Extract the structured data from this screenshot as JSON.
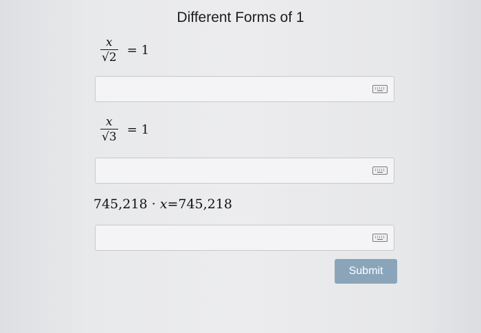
{
  "title": "Different Forms of 1",
  "problems": [
    {
      "numerator": "x",
      "radicand": "2",
      "rhs": "= 1"
    },
    {
      "numerator": "x",
      "radicand": "3",
      "rhs": "= 1"
    },
    {
      "left_number": "745,218",
      "dot": "·",
      "variable": "x",
      "equals": "=",
      "right_number": "745,218"
    }
  ],
  "answers": [
    {
      "value": "",
      "keyboard_icon": "keyboard-icon"
    },
    {
      "value": "",
      "keyboard_icon": "keyboard-icon"
    },
    {
      "value": "",
      "keyboard_icon": "keyboard-icon"
    }
  ],
  "submit_label": "Submit",
  "colors": {
    "submit_bg": "#8aa5b9",
    "page_bg": "#e9e9eb"
  }
}
